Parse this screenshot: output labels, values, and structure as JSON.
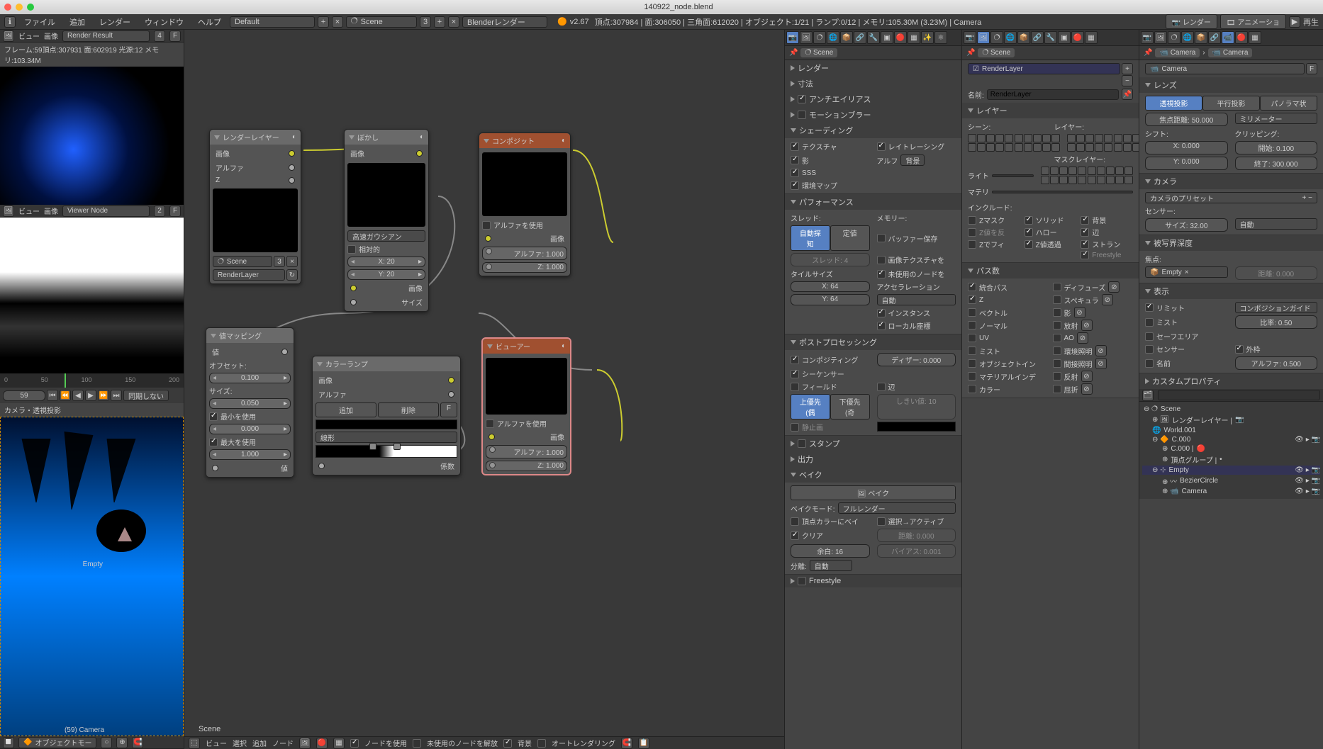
{
  "title": "140922_node.blend",
  "menu": {
    "file": "ファイル",
    "add": "追加",
    "render": "レンダー",
    "window": "ウィンドウ",
    "help": "ヘルプ"
  },
  "topbar": {
    "layout": "Default",
    "scene": "Scene",
    "engine": "Blenderレンダー",
    "version": "v2.67",
    "stats": "頂点:307984 | 面:306050 | 三角面:612020 | オブジェクト:1/21 | ランプ:0/12 | メモリ:105.30M (3.23M) | Camera"
  },
  "rightbtns": {
    "render": "レンダー",
    "anim": "アニメーショ",
    "play": "再生"
  },
  "left": {
    "imgheader": {
      "view": "ビュー",
      "image": "画像",
      "select": "Render Result",
      "idx": "4"
    },
    "renderinfo": "フレーム:59頂点:307931 面:602919 光源:12 メモリ:103.34M",
    "viewer_select": "Viewer Node",
    "viewer_idx": "2",
    "tl_marks": [
      "0",
      "50",
      "100",
      "150",
      "200"
    ],
    "frame": "59",
    "sync": "同期しない",
    "vp_label": "カメラ・透視投影",
    "vp_empty": "Empty",
    "vp_cam": "(59) Camera",
    "vp_footer": "オブジェクトモー"
  },
  "nodes": {
    "renderlayers": {
      "title": "レンダーレイヤー",
      "out_image": "画像",
      "out_alpha": "アルファ",
      "out_z": "Z",
      "scene": "Scene",
      "scene_idx": "3",
      "layer": "RenderLayer"
    },
    "blur": {
      "title": "ぼかし",
      "out_image": "画像",
      "type": "高速ガウシアン",
      "relative": "相対的",
      "x": "X: 20",
      "y": "Y: 20",
      "in_image": "画像",
      "in_size": "サイズ"
    },
    "composite": {
      "title": "コンポジット",
      "use_alpha": "アルファを使用",
      "in_image": "画像",
      "alpha": "アルファ: 1.000",
      "z": "Z: 1.000"
    },
    "viewer": {
      "title": "ビューアー",
      "use_alpha": "アルファを使用",
      "in_image": "画像",
      "alpha": "アルファ: 1.000",
      "z": "Z: 1.000"
    },
    "mapvalue": {
      "title": "値マッピング",
      "out": "値",
      "offset": "オフセット:",
      "offset_v": "0.100",
      "size": "サイズ:",
      "size_v": "0.050",
      "usemin": "最小を使用",
      "min_v": "0.000",
      "usemax": "最大を使用",
      "max_v": "1.000",
      "in": "値"
    },
    "colorramp": {
      "title": "カラーランプ",
      "out_image": "画像",
      "out_alpha": "アルファ",
      "add": "追加",
      "del": "削除",
      "f": "F",
      "interp": "線形",
      "in": "係数"
    }
  },
  "node_footer": {
    "view": "ビュー",
    "select": "選択",
    "add": "追加",
    "node": "ノード",
    "use": "ノードを使用",
    "free": "未使用のノードを解放",
    "backdrop": "背景",
    "auto": "オートレンダリング",
    "scene_label": "Scene"
  },
  "props": {
    "breadcrumb": "Scene",
    "sections": {
      "render": "レンダー",
      "dim": "寸法",
      "aa": "アンチエイリアス",
      "mblur": "モーションブラー",
      "shading": "シェーディング",
      "perf": "パフォーマンス",
      "post": "ポストプロセッシング",
      "stamp": "スタンプ",
      "output": "出力",
      "bake": "ベイク",
      "freestyle": "Freestyle"
    },
    "shading": {
      "texture": "テクスチャ",
      "shadow": "影",
      "sss": "SSS",
      "envmap": "環境マップ",
      "raytrace": "レイトレーシング",
      "alpha": "アルフ",
      "alpha_v": "背景"
    },
    "perf": {
      "thread": "スレッド:",
      "auto": "自動探知",
      "fixed": "定値",
      "threads": "スレッド: 4",
      "tile": "タイルサイズ",
      "x": "X: 64",
      "y": "Y: 64",
      "mem": "メモリー:",
      "savebuf": "バッファー保存",
      "imgtex": "画像テクスチャを",
      "freenode": "未使用のノードを",
      "accel": "アクセラレーション",
      "accel_v": "自動",
      "instance": "インスタンス",
      "local": "ローカル座標"
    },
    "post": {
      "comp": "コンポジティング",
      "seq": "シーケンサー",
      "dither": "ディザー: 0.000",
      "fields": "フィールド",
      "odd": "辺",
      "upfirst": "上優先(偶",
      "lowfirst": "下優先(奇",
      "still": "静止画",
      "thresh": "しきい値: 10"
    },
    "bake": {
      "btn": "ベイク",
      "mode": "ベイクモード:",
      "mode_v": "フルレンダー",
      "vcol": "頂点カラーにベイ",
      "sel": "選択→アクティブ",
      "clear": "クリア",
      "dist": "距離: 0.000",
      "margin": "余白: 16",
      "bias": "バイアス: 0.001",
      "split": "分離:",
      "split_v": "自動"
    }
  },
  "layers": {
    "breadcrumb": "Scene",
    "rl_name": "RenderLayer",
    "name_label": "名前:",
    "sec": "レイヤー",
    "scene_l": "シーン:",
    "layer_l": "レイヤー:",
    "mask_l": "マスクレイヤー:",
    "light_l": "ライト",
    "mat_l": "マテリ",
    "include": "インクルード:",
    "zmask": "Zマスク",
    "zinv": "Z値を反",
    "ztra": "Zでフィ",
    "solid": "ソリッド",
    "halo": "ハロー",
    "zt": "Z値透過",
    "sky": "背景",
    "edge": "辺",
    "strand": "ストラン",
    "fs": "Freestyle",
    "passes": "パス数",
    "combined": "統合パス",
    "z": "Z",
    "vector": "ベクトル",
    "normal": "ノーマル",
    "uv": "UV",
    "mist": "ミスト",
    "objidx": "オブジェクトイン",
    "matidx": "マテリアルインデ",
    "color": "カラー",
    "diffuse": "ディフューズ",
    "spec": "スペキュラ",
    "shadow": "影",
    "emit": "放射",
    "ao": "AO",
    "env": "環境照明",
    "indirect": "間接照明",
    "reflect": "反射",
    "refract": "屈折"
  },
  "camera": {
    "bc1": "Camera",
    "bc2": "Camera",
    "name": "Camera",
    "name_f": "F",
    "lens": "レンズ",
    "persp": "透視投影",
    "ortho": "平行投影",
    "pano": "パノラマ状",
    "focal": "焦点距離: 50.000",
    "unit": "ミリメーター",
    "shift": "シフト:",
    "sx": "X: 0.000",
    "sy": "Y: 0.000",
    "clip": "クリッピング:",
    "cs": "開始: 0.100",
    "ce": "終了: 300.000",
    "cam_sec": "カメラ",
    "preset": "カメラのプリセット",
    "sensor": "センサー:",
    "size": "サイズ: 32.00",
    "fit": "自動",
    "dof": "被写界深度",
    "focus": "焦点:",
    "focus_obj": "Empty",
    "dist": "距離: 0.000",
    "display": "表示",
    "limits": "リミット",
    "mist": "ミスト",
    "safe": "セーフエリア",
    "sens": "センサー",
    "name_d": "名前",
    "guide": "コンポジションガイド",
    "passe": "外枠",
    "alpha": "アルファ: 0.500",
    "pass_ratio": "比率: 0.50",
    "custom": "カスタムプロパティ"
  },
  "outliner": {
    "scene": "Scene",
    "rl": "レンダーレイヤー |",
    "world": "World.001",
    "c000": "C.000",
    "c000b": "C.000 |",
    "vg": "頂点グループ |",
    "empty": "Empty",
    "bezier": "BezierCircle",
    "cam": "Camera"
  }
}
